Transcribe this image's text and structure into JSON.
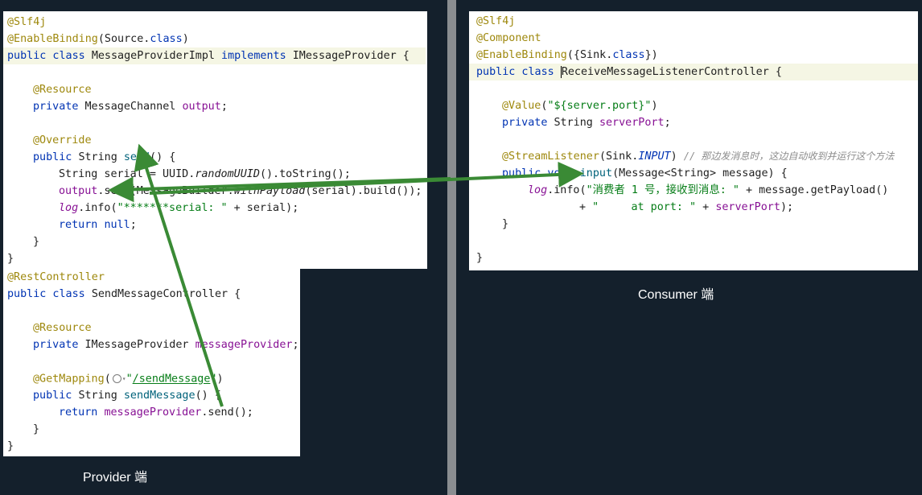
{
  "left_top_code": {
    "l1": "@Slf4j",
    "l2a": "@EnableBinding",
    "l2b": "(Source.",
    "l2c": "class",
    "l2d": ")",
    "l3a": "public class ",
    "l3b": "MessageProviderImpl",
    "l3c": " implements ",
    "l3d": "IMessageProvider {",
    "l5": "@Resource",
    "l6a": "private ",
    "l6b": "MessageChannel ",
    "l6c": "output",
    "l6d": ";",
    "l8": "@Override",
    "l9a": "public ",
    "l9b": "String ",
    "l9c": "send",
    "l9d": "() {",
    "l10a": "String serial = UUID.",
    "l10b": "randomUUID",
    "l10c": "().toString();",
    "l11a": "output",
    "l11b": ".send(MessageBuilder.",
    "l11c": "withPayload",
    "l11d": "(serial).build());",
    "l12a": "log",
    "l12b": ".info(",
    "l12c": "\"*******serial: \"",
    "l12d": " + serial);",
    "l13a": "return ",
    "l13b": "null",
    "l13c": ";",
    "l14": "}",
    "l15": "}"
  },
  "left_bottom_code": {
    "l1": "@RestController",
    "l2a": "public class ",
    "l2b": "SendMessageController {",
    "l4": "@Resource",
    "l5a": "private ",
    "l5b": "IMessageProvider ",
    "l5c": "messageProvider",
    "l5d": ";",
    "l7a": "@GetMapping",
    "l7b": "(",
    "l7c": "\"",
    "l7d": "/sendMessage",
    "l7e": "\"",
    "l7f": ")",
    "l8a": "public ",
    "l8b": "String ",
    "l8c": "sendMessage",
    "l8d": "() {",
    "l9a": "return ",
    "l9b": "messageProvider",
    "l9c": ".send();",
    "l10": "}",
    "l11": "}"
  },
  "right_code": {
    "l1": "@Slf4j",
    "l2": "@Component",
    "l3a": "@EnableBinding",
    "l3b": "({Sink.",
    "l3c": "class",
    "l3d": "})",
    "l4a": "public class ",
    "l4b": "ReceiveMessageListenerController {",
    "l6a": "@Value",
    "l6b": "(",
    "l6c": "\"${server.port}\"",
    "l6d": ")",
    "l7a": "private ",
    "l7b": "String ",
    "l7c": "serverPort",
    "l7d": ";",
    "l9a": "@StreamListener",
    "l9b": "(Sink.",
    "l9c": "INPUT",
    "l9d": ") ",
    "l9e": "// 那边发消息时，这边自动收到并运行这个方法",
    "l10a": "public void ",
    "l10b": "input",
    "l10c": "(Message<String> message) {",
    "l11a": "log",
    "l11b": ".info(",
    "l11c": "\"消费者 1 号，接收到消息: \"",
    "l11d": " + message.getPayload()",
    "l12a": "+ ",
    "l12b": "\"     at port: \"",
    "l12c": " + ",
    "l12d": "serverPort",
    "l12e": ");",
    "l13": "}",
    "l15": "}"
  },
  "captions": {
    "consumer": "Consumer 端",
    "provider": "Provider 端"
  },
  "colors": {
    "annotation": "#9e880d",
    "keyword": "#0033b3",
    "field": "#871094",
    "string": "#067d17",
    "arrow": "#3a8a35"
  }
}
